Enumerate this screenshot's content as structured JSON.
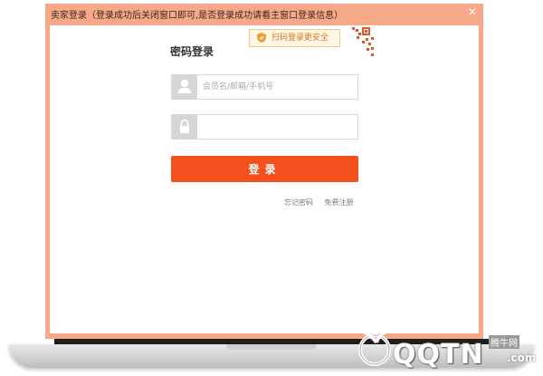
{
  "window": {
    "title": "卖家登录（登录成功后关闭窗口即可,是否登录成功请看主窗口登录信息）",
    "close_symbol": "×"
  },
  "qr_tip": {
    "text": "扫码登录更安全"
  },
  "login": {
    "title": "密码登录",
    "username_placeholder": "会员名/邮箱/手机号",
    "username_value": "",
    "password_placeholder": "",
    "password_value": "",
    "submit_label": "登录",
    "forgot_password": "忘记密码",
    "register": "免费注册"
  },
  "watermark": {
    "brand": "QQTN",
    "domain": ".com",
    "cn_text": "腾牛网"
  },
  "colors": {
    "window_frame": "#f6a888",
    "submit_button": "#f4501e",
    "qr_tip_text": "#d07a1e",
    "qr_tip_background": "#fff6e5"
  },
  "icons": {
    "username": "user-icon",
    "password": "lock-icon",
    "qr_tip": "shield-icon",
    "qr_code": "qr-code-icon",
    "close": "close-icon"
  }
}
